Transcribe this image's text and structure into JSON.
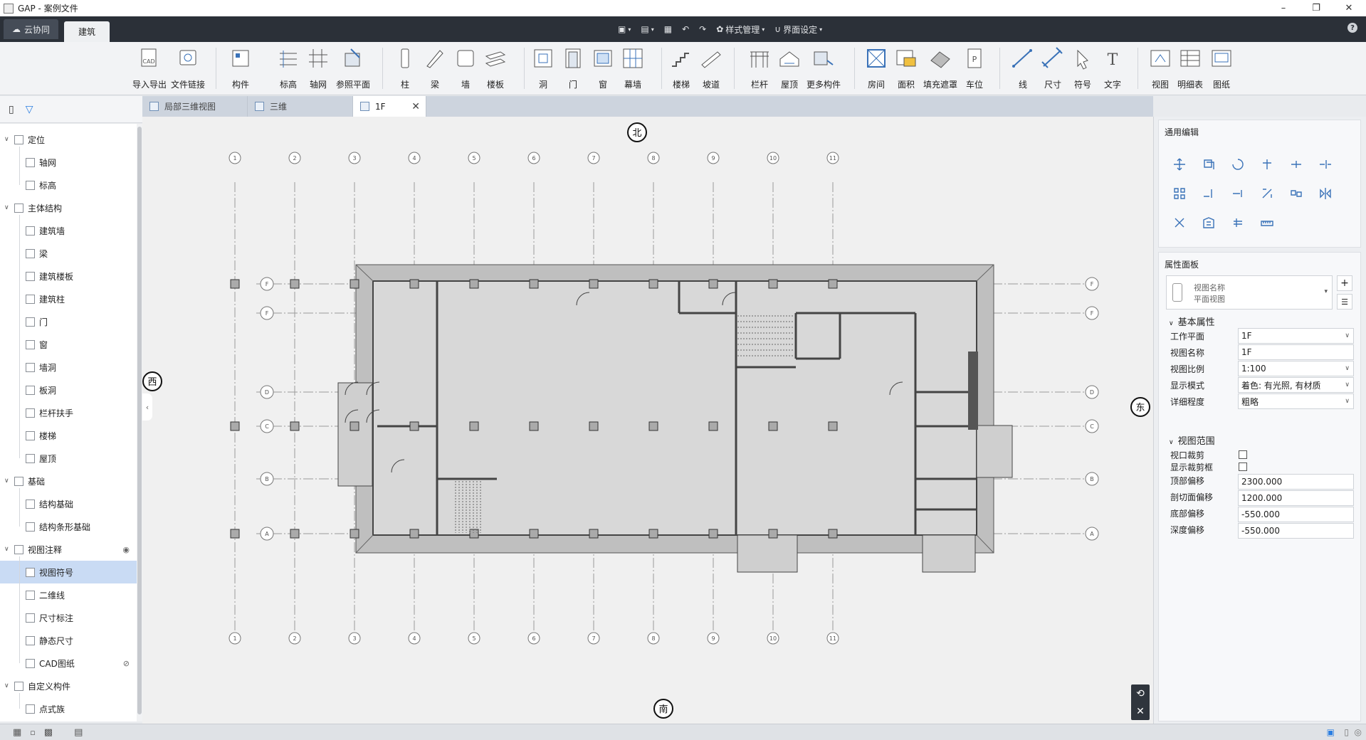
{
  "window": {
    "title": "GAP - 案例文件",
    "minimize": "–",
    "maximize": "❐",
    "close": "✕"
  },
  "menubar": {
    "cloud_tab": "云协同",
    "active_tab": "建筑",
    "help": "?"
  },
  "quick": {
    "style_manage": "样式管理",
    "ui_settings": "界面设定"
  },
  "ribbon": [
    {
      "label": "导入导出",
      "icon": "cad-import-icon"
    },
    {
      "label": "文件链接",
      "icon": "file-link-icon"
    },
    {
      "label": "构件",
      "icon": "component-icon"
    },
    {
      "label": "标高",
      "icon": "level-icon"
    },
    {
      "label": "轴网",
      "icon": "grid-icon"
    },
    {
      "label": "参照平面",
      "icon": "reference-plane-icon"
    },
    {
      "label": "柱",
      "icon": "column-icon"
    },
    {
      "label": "梁",
      "icon": "beam-icon"
    },
    {
      "label": "墙",
      "icon": "wall-icon"
    },
    {
      "label": "楼板",
      "icon": "floor-icon"
    },
    {
      "label": "洞",
      "icon": "opening-icon"
    },
    {
      "label": "门",
      "icon": "door-icon"
    },
    {
      "label": "窗",
      "icon": "window-icon"
    },
    {
      "label": "幕墙",
      "icon": "curtain-wall-icon"
    },
    {
      "label": "楼梯",
      "icon": "stair-icon"
    },
    {
      "label": "坡道",
      "icon": "ramp-icon"
    },
    {
      "label": "栏杆",
      "icon": "railing-icon"
    },
    {
      "label": "屋顶",
      "icon": "roof-icon"
    },
    {
      "label": "更多构件",
      "icon": "more-components-icon"
    },
    {
      "label": "房间",
      "icon": "room-icon"
    },
    {
      "label": "面积",
      "icon": "area-icon"
    },
    {
      "label": "填充遮罩",
      "icon": "fill-mask-icon"
    },
    {
      "label": "车位",
      "icon": "parking-icon"
    },
    {
      "label": "线",
      "icon": "line-icon"
    },
    {
      "label": "尺寸",
      "icon": "dimension-icon"
    },
    {
      "label": "符号",
      "icon": "symbol-icon"
    },
    {
      "label": "文字",
      "icon": "text-icon"
    },
    {
      "label": "视图",
      "icon": "view-icon"
    },
    {
      "label": "明细表",
      "icon": "schedule-icon"
    },
    {
      "label": "图纸",
      "icon": "sheet-icon"
    }
  ],
  "tabs": [
    {
      "label": "局部三维视图"
    },
    {
      "label": "三维"
    },
    {
      "label": "1F"
    }
  ],
  "tree": [
    {
      "label": "定位",
      "level": 0
    },
    {
      "label": "轴网",
      "level": 1
    },
    {
      "label": "标高",
      "level": 1
    },
    {
      "label": "主体结构",
      "level": 0
    },
    {
      "label": "建筑墙",
      "level": 1
    },
    {
      "label": "梁",
      "level": 1
    },
    {
      "label": "建筑楼板",
      "level": 1
    },
    {
      "label": "建筑柱",
      "level": 1
    },
    {
      "label": "门",
      "level": 1
    },
    {
      "label": "窗",
      "level": 1
    },
    {
      "label": "墙洞",
      "level": 1
    },
    {
      "label": "板洞",
      "level": 1
    },
    {
      "label": "栏杆扶手",
      "level": 1
    },
    {
      "label": "楼梯",
      "level": 1
    },
    {
      "label": "屋顶",
      "level": 1
    },
    {
      "label": "基础",
      "level": 0
    },
    {
      "label": "结构基础",
      "level": 1
    },
    {
      "label": "结构条形基础",
      "level": 1
    },
    {
      "label": "视图注释",
      "level": 0
    },
    {
      "label": "视图符号",
      "level": 1
    },
    {
      "label": "二维线",
      "level": 1
    },
    {
      "label": "尺寸标注",
      "level": 1
    },
    {
      "label": "静态尺寸",
      "level": 1
    },
    {
      "label": "CAD图纸",
      "level": 1
    },
    {
      "label": "自定义构件",
      "level": 0
    },
    {
      "label": "点式族",
      "level": 1
    }
  ],
  "drawing": {
    "compass": {
      "north": "北",
      "south": "南",
      "west": "西",
      "east": "东"
    },
    "grid_numbers": [
      "1",
      "2",
      "3",
      "4",
      "5",
      "6",
      "7",
      "8",
      "9",
      "10",
      "11"
    ],
    "grid_letters": [
      "F",
      "F",
      "D",
      "C",
      "B",
      "A"
    ]
  },
  "panel": {
    "edit_title": "通用编辑",
    "prop_title": "属性面板",
    "view_type_name": "视图名称",
    "view_type_sub": "平面视图",
    "basic_section": "基本属性",
    "range_section": "视图范围",
    "props": [
      {
        "label": "工作平面",
        "value": "1F",
        "dropdown": true
      },
      {
        "label": "视图名称",
        "value": "1F",
        "dropdown": false
      },
      {
        "label": "视图比例",
        "value": "1:100",
        "dropdown": true
      },
      {
        "label": "显示模式",
        "value": "着色: 有光照, 有材质",
        "dropdown": true
      },
      {
        "label": "详细程度",
        "value": "粗略",
        "dropdown": true
      }
    ],
    "checks": [
      {
        "label": "视口裁剪"
      },
      {
        "label": "显示裁剪框"
      }
    ],
    "offsets": [
      {
        "label": "顶部偏移",
        "value": "2300.000"
      },
      {
        "label": "剖切面偏移",
        "value": "1200.000"
      },
      {
        "label": "底部偏移",
        "value": "-550.000"
      },
      {
        "label": "深度偏移",
        "value": "-550.000"
      }
    ]
  }
}
